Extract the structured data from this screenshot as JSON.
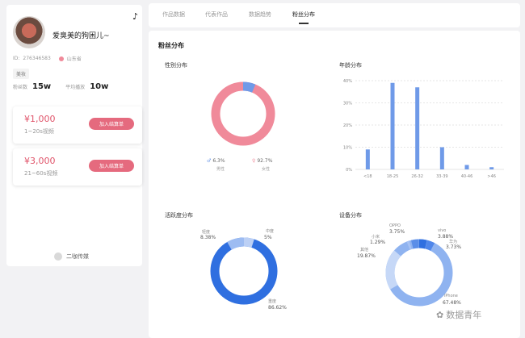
{
  "profile": {
    "username": "爱臭美的狗困儿~",
    "id_label": "ID:",
    "id_value": "276346583",
    "location": "山东省",
    "tag": "美妆",
    "fans_label": "粉丝数",
    "fans_value": "15w",
    "avg_play_label": "平均播放",
    "avg_play_value": "10w"
  },
  "price_cards": [
    {
      "price": "¥1,000",
      "desc": "1~20s视频",
      "button": "加入结算单"
    },
    {
      "price": "¥3,000",
      "desc": "21~60s视频",
      "button": "加入结算单"
    }
  ],
  "footer_brand": "二咖传媒",
  "tabs": [
    "作品数据",
    "代表作品",
    "数据趋势",
    "粉丝分布"
  ],
  "active_tab": "粉丝分布",
  "section_title": "粉丝分布",
  "gender": {
    "title": "性别分布",
    "male_pct": "6.3%",
    "male_label": "男性",
    "female_pct": "92.7%",
    "female_label": "女性",
    "colors": {
      "female": "#f08a9a",
      "male": "#6f9ae8"
    }
  },
  "activity": {
    "title": "活跃度分布",
    "items": [
      {
        "name": "轻度",
        "pct": "8.38%"
      },
      {
        "name": "中度",
        "pct": "5%"
      },
      {
        "name": "重度",
        "pct": "86.62%"
      }
    ]
  },
  "device": {
    "title": "设备分布",
    "items": [
      {
        "name": "OPPO",
        "pct": "3.75%"
      },
      {
        "name": "vivo",
        "pct": "3.88%"
      },
      {
        "name": "小米",
        "pct": "1.29%"
      },
      {
        "name": "华为",
        "pct": "3.73%"
      },
      {
        "name": "其他",
        "pct": "19.87%"
      },
      {
        "name": "iPhone",
        "pct": "67.48%"
      }
    ]
  },
  "age_chart_title": "年龄分布",
  "chart_data": [
    {
      "type": "pie",
      "title": "性别分布",
      "categories": [
        "女性",
        "男性"
      ],
      "values": [
        92.7,
        6.3
      ]
    },
    {
      "type": "bar",
      "title": "年龄分布",
      "categories": [
        "<18",
        "18-25",
        "26-32",
        "33-39",
        "40-46",
        ">46"
      ],
      "values": [
        9,
        39,
        37,
        10,
        2,
        1
      ],
      "ylim": [
        0,
        40
      ],
      "yticks": [
        "0%",
        "10%",
        "20%",
        "30%",
        "40%"
      ],
      "color": "#6f9ae8",
      "grid": true
    },
    {
      "type": "pie",
      "title": "活跃度分布",
      "categories": [
        "轻度",
        "中度",
        "重度"
      ],
      "values": [
        8.38,
        5,
        86.62
      ]
    },
    {
      "type": "pie",
      "title": "设备分布",
      "categories": [
        "OPPO",
        "vivo",
        "小米",
        "华为",
        "其他",
        "iPhone"
      ],
      "values": [
        3.75,
        3.88,
        1.29,
        3.73,
        19.87,
        67.48
      ]
    }
  ],
  "watermark": "数据青年"
}
